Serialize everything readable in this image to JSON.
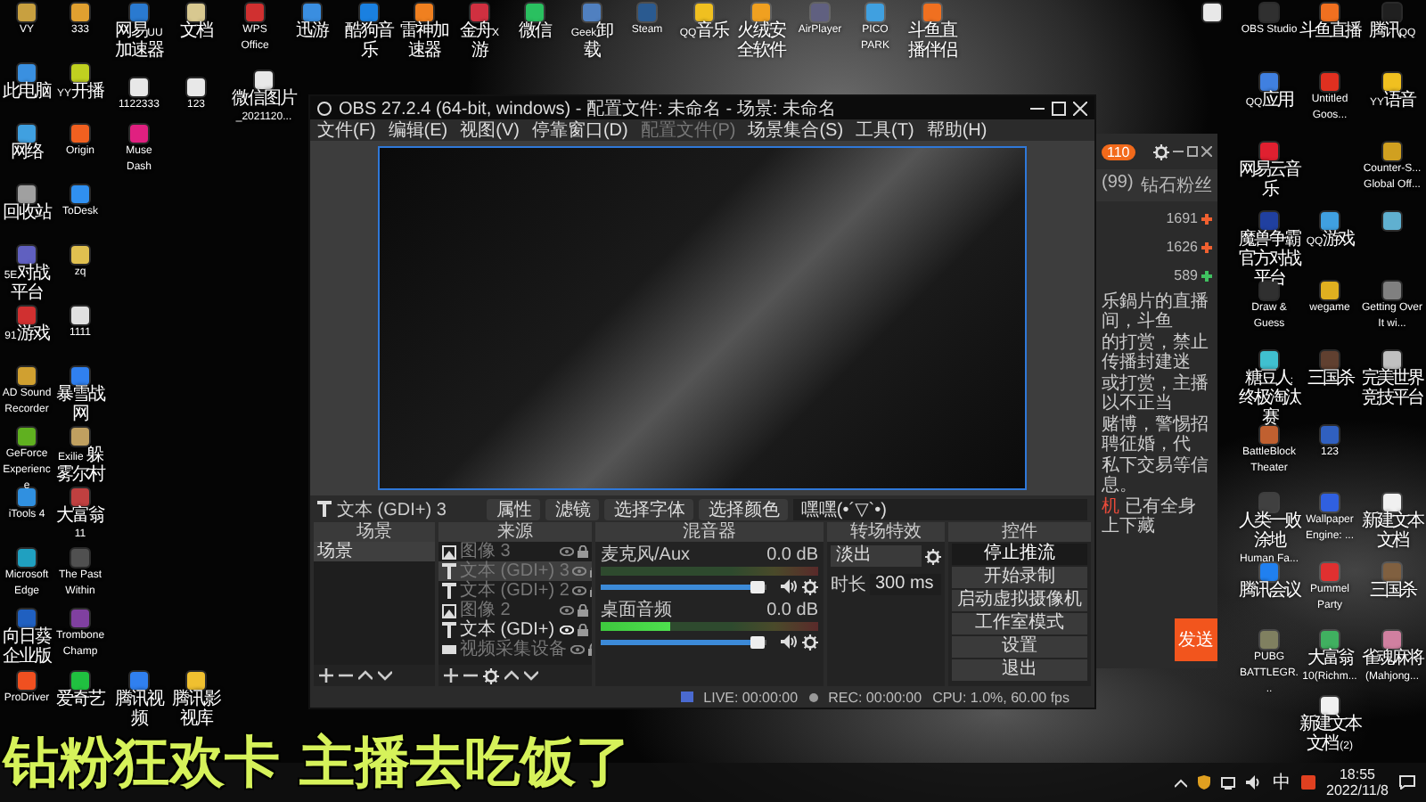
{
  "desktop_icons": [
    {
      "label": "VY",
      "color": "#c8a040"
    },
    {
      "label": "333",
      "color": "#e0a030"
    },
    {
      "label": "网易UU加速器",
      "color": "#2a7ad0"
    },
    {
      "label": "文档",
      "color": "#d8c890"
    },
    {
      "label": "WPS Office",
      "color": "#d03030"
    },
    {
      "label": "迅游",
      "color": "#3a8ee0"
    },
    {
      "label": "酷狗音乐",
      "color": "#1a80e0"
    },
    {
      "label": "雷神加速器",
      "color": "#f08020"
    },
    {
      "label": "金舟X游",
      "color": "#d03040"
    },
    {
      "label": "微信",
      "color": "#2ac060"
    },
    {
      "label": "Geek卸载",
      "color": "#5080c0"
    },
    {
      "label": "Steam",
      "color": "#2a5a90"
    },
    {
      "label": "QQ音乐",
      "color": "#f0c020"
    },
    {
      "label": "火绒安全软件",
      "color": "#f0a020"
    },
    {
      "label": "AirPlayer",
      "color": "#606080"
    },
    {
      "label": "PICO PARK",
      "color": "#40a0e0"
    },
    {
      "label": "斗鱼直播伴侣",
      "color": "#f07020"
    },
    {
      "label": "此电脑",
      "color": "#3a90e0"
    },
    {
      "label": "YY开播",
      "color": "#c0d020"
    },
    {
      "label": "1122333",
      "color": "#e8e8e8"
    },
    {
      "label": "123",
      "color": "#e8e8e8"
    },
    {
      "label": "微信图片_2021120...",
      "color": "#e8e8e8"
    },
    {
      "label": "网络",
      "color": "#40a0e0"
    },
    {
      "label": "Origin",
      "color": "#f06020"
    },
    {
      "label": "Muse Dash",
      "color": "#e02080"
    },
    {
      "label": "回收站",
      "color": "#a0a0a0"
    },
    {
      "label": "ToDesk",
      "color": "#3090f0"
    },
    {
      "label": "5E对战平台",
      "color": "#6060c0"
    },
    {
      "label": "zq",
      "color": "#e0c050"
    },
    {
      "label": "91游戏",
      "color": "#d03030"
    },
    {
      "label": "1111",
      "color": "#e0e0e0"
    },
    {
      "label": "AD Sound Recorder",
      "color": "#d0a030"
    },
    {
      "label": "暴雪战网",
      "color": "#3080f0"
    },
    {
      "label": "GeForce Experience",
      "color": "#60b020"
    },
    {
      "label": "Exilie 躲雾尔村",
      "color": "#c0a060"
    },
    {
      "label": "iTools 4",
      "color": "#3090e0"
    },
    {
      "label": "大富翁11",
      "color": "#c04040"
    },
    {
      "label": "Microsoft Edge",
      "color": "#20a0c0"
    },
    {
      "label": "The Past Within",
      "color": "#505050"
    },
    {
      "label": "向日葵企业版",
      "color": "#2060c0"
    },
    {
      "label": "Trombone Champ",
      "color": "#8040a0"
    },
    {
      "label": "ProDriver",
      "color": "#f05020"
    },
    {
      "label": "爱奇艺",
      "color": "#20c040"
    },
    {
      "label": "腾讯视频",
      "color": "#3080f0"
    },
    {
      "label": "腾讯影视库",
      "color": "#f0c030"
    }
  ],
  "right_icons": [
    {
      "color": "#e8e8e8"
    },
    {
      "label": "OBS Studio",
      "color": "#303030"
    },
    {
      "label": "斗鱼直播",
      "color": "#f07020"
    },
    {
      "label": "腾讯QQ",
      "color": "#202020"
    },
    {
      "label": "QQ应用",
      "color": "#4080e0"
    },
    {
      "label": "Untitled Goos...",
      "color": "#e03020"
    },
    {
      "label": "YY语音",
      "color": "#f0c020"
    },
    {
      "label": "网易云音乐",
      "color": "#e02030"
    },
    {
      "label": "Counter-S... Global Off...",
      "color": "#d0a020"
    },
    {
      "label": "魔兽争霸官方对战平台",
      "color": "#2040a0"
    },
    {
      "label": "QQ游戏",
      "color": "#40a0e0"
    },
    {
      "color": "#60b0d0"
    },
    {
      "label": "Draw & Guess",
      "color": "#303030"
    },
    {
      "label": "wegame",
      "color": "#e0b020"
    },
    {
      "label": "Getting Over It wi...",
      "color": "#808080"
    },
    {
      "label": "糖豆人: 终极淘汰赛",
      "color": "#40c0d0"
    },
    {
      "label": "三国杀",
      "color": "#604030"
    },
    {
      "label": "完美世界竞技平台",
      "color": "#c0c0c0"
    },
    {
      "label": "BattleBlock Theater",
      "color": "#c06030"
    },
    {
      "label": "123",
      "color": "#3060c0"
    },
    {
      "label": "人类一败涂地 Human Fa...",
      "color": "#404040"
    },
    {
      "label": "Wallpaper Engine: ...",
      "color": "#3060e0"
    },
    {
      "label": "新建文本文档",
      "color": "#f0f0f0"
    },
    {
      "label": "腾讯会议",
      "color": "#2080f0"
    },
    {
      "label": "Pummel Party",
      "color": "#e03030"
    },
    {
      "label": "三国杀",
      "color": "#806040"
    },
    {
      "label": "PUBG BATTLEGR...",
      "color": "#808060"
    },
    {
      "label": "大富翁10(Richm...",
      "color": "#40b060"
    },
    {
      "label": "雀魂麻将(Mahjong...",
      "color": "#d080a0"
    },
    {
      "label": "新建文本文档 (2)",
      "color": "#f0f0f0"
    }
  ],
  "chat_window": {
    "badge": "110",
    "headings": [
      "(99)",
      "钻石粉丝"
    ],
    "ranks": [
      {
        "value": "1691",
        "color": "#f06030"
      },
      {
        "value": "1626",
        "color": "#f06030"
      },
      {
        "value": "589",
        "color": "#40c060"
      }
    ],
    "notice": [
      {
        "text": "乐鍋片的直播间，斗鱼"
      },
      {
        "text": "的打赏，禁止传播封建迷"
      },
      {
        "text": "或打赏，主播以不正当"
      },
      {
        "text": "赌博，警惕招聘征婚，代"
      },
      {
        "text": "私下交易等信息。"
      },
      {
        "highlight": "机",
        "text": " 已有全身上下藏"
      }
    ],
    "send_button": "发送"
  },
  "obs": {
    "title": "OBS 27.2.4 (64-bit, windows) - 配置文件: 未命名 - 场景: 未命名",
    "menu": [
      {
        "label": "文件(F)",
        "disabled": false
      },
      {
        "label": "编辑(E)",
        "disabled": false
      },
      {
        "label": "视图(V)",
        "disabled": false
      },
      {
        "label": "停靠窗口(D)",
        "disabled": false
      },
      {
        "label": "配置文件(P)",
        "disabled": true
      },
      {
        "label": "场景集合(S)",
        "disabled": false
      },
      {
        "label": "工具(T)",
        "disabled": false
      },
      {
        "label": "帮助(H)",
        "disabled": false
      }
    ],
    "source_toolbar": {
      "source": "文本 (GDI+) 3",
      "buttons": [
        "属性",
        "滤镜"
      ],
      "actions": [
        "选择字体",
        "选择颜色"
      ],
      "text_value": "嘿嘿(•´▽`•)"
    },
    "scenes": {
      "title": "场景",
      "items": [
        {
          "label": "场景",
          "selected": true
        }
      ]
    },
    "sources": {
      "title": "来源",
      "items": [
        {
          "kind": "image",
          "label": "图像 3",
          "visible": false,
          "selected": false
        },
        {
          "kind": "text",
          "label": "文本 (GDI+) 3",
          "visible": false,
          "selected": true
        },
        {
          "kind": "text",
          "label": "文本 (GDI+) 2",
          "visible": false,
          "selected": false
        },
        {
          "kind": "image",
          "label": "图像 2",
          "visible": false,
          "selected": false
        },
        {
          "kind": "text",
          "label": "文本 (GDI+)",
          "visible": true,
          "selected": false
        },
        {
          "kind": "video",
          "label": "视频采集设备",
          "visible": false,
          "selected": false
        }
      ]
    },
    "mixer": {
      "title": "混音器",
      "channels": [
        {
          "name": "麦克风/Aux",
          "reading": "0.0 dB",
          "volume": {
            "level": 0.95
          }
        },
        {
          "name": "桌面音频",
          "reading": "0.0 dB",
          "meter": {
            "level": 0.32
          },
          "volume": {
            "level": 0.95
          }
        }
      ]
    },
    "transitions": {
      "title": "转场特效",
      "selected": "淡出",
      "duration_label": "时长",
      "duration": "300 ms"
    },
    "controls": {
      "title": "控件",
      "buttons": [
        {
          "label": "停止推流",
          "active": true
        },
        {
          "label": "开始录制",
          "active": false
        },
        {
          "label": "启动虚拟摄像机",
          "active": false
        },
        {
          "label": "工作室模式",
          "active": false
        },
        {
          "label": "设置",
          "active": false
        },
        {
          "label": "退出",
          "active": false
        }
      ]
    },
    "status": {
      "live": "LIVE: 00:00:00",
      "rec": "REC: 00:00:00",
      "cpu": "CPU: 1.0%, 60.00 fps"
    }
  },
  "subtitle": "钻粉狂欢卡 主播去吃饭了",
  "taskbar": {
    "ime": "中",
    "time": "18:55",
    "date": "2022/11/8"
  }
}
